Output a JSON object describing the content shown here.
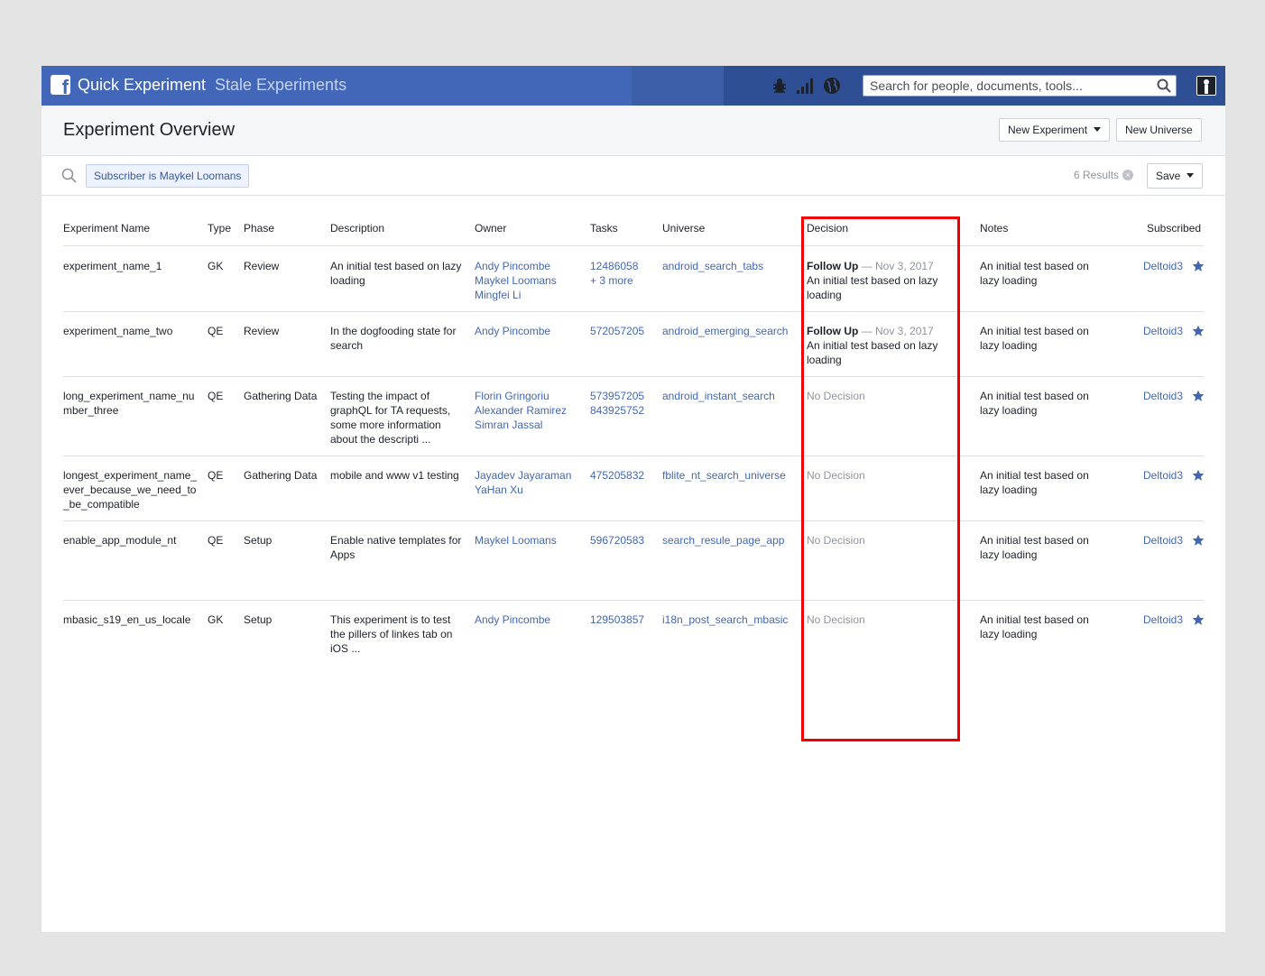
{
  "topbar": {
    "app_name": "Quick Experiment",
    "section": "Stale Experiments",
    "search_placeholder": "Search for people, documents, tools...",
    "fb_letter": "f",
    "brand_color": "#4367b8"
  },
  "header": {
    "title": "Experiment Overview",
    "new_experiment_label": "New Experiment",
    "new_universe_label": "New Universe"
  },
  "filter": {
    "chip_prefix": "Subscriber is ",
    "chip_value": "Maykel Loomans",
    "results": "6 Results",
    "save_label": "Save"
  },
  "table": {
    "columns": [
      "Experiment Name",
      "Type",
      "Phase",
      "Description",
      "Owner",
      "Tasks",
      "Universe",
      "Decision",
      "Notes",
      "Subscribed"
    ],
    "rows": [
      {
        "name": [
          "experiment_name_1"
        ],
        "type": "GK",
        "phase": "Review",
        "description": [
          "An initial test based on lazy",
          "loading"
        ],
        "owners": [
          "Andy Pincombe",
          "Maykel Loomans",
          "Mingfei Li"
        ],
        "tasks": [
          "12486058",
          "+ 3 more"
        ],
        "universe": "android_search_tabs",
        "decision_status": "Follow Up",
        "decision_date": "— Nov 3, 2017",
        "decision_note": [
          "An initial test based on lazy",
          "loading"
        ],
        "notes": [
          "An initial test based on",
          "lazy loading"
        ],
        "subscriber": "Deltoid3"
      },
      {
        "name": [
          "experiment_name_two"
        ],
        "type": "QE",
        "phase": "Review",
        "description": [
          "In the dogfooding state for",
          "search"
        ],
        "owners": [
          "Andy Pincombe"
        ],
        "tasks": [
          "572057205"
        ],
        "universe": "android_emerging_search",
        "decision_status": "Follow Up",
        "decision_date": "— Nov 3, 2017",
        "decision_note": [
          "An initial test based on lazy",
          "loading"
        ],
        "notes": [
          "An initial test based on",
          "lazy loading"
        ],
        "subscriber": "Deltoid3"
      },
      {
        "name": [
          "long_experiment_name_nu",
          "mber_three"
        ],
        "type": "QE",
        "phase": "Gathering Data",
        "description": [
          "Testing the impact of",
          "graphQL for TA requests,",
          "some more information",
          "about the descripti ..."
        ],
        "owners": [
          "Florin Gringoriu",
          "Alexander Ramirez",
          "Simran Jassal"
        ],
        "tasks": [
          "573957205",
          "843925752"
        ],
        "universe": "android_instant_search",
        "decision_status": "No Decision",
        "notes": [
          "An initial test based on",
          "lazy loading"
        ],
        "subscriber": "Deltoid3"
      },
      {
        "name": [
          "longest_experiment_name_",
          "ever_because_we_need_to",
          "_be_compatible"
        ],
        "type": "QE",
        "phase": "Gathering Data",
        "description": [
          "mobile and www v1 testing"
        ],
        "owners": [
          "Jayadev Jayaraman",
          "YaHan Xu"
        ],
        "tasks": [
          "475205832"
        ],
        "universe": "fblite_nt_search_universe",
        "decision_status": "No Decision",
        "notes": [
          "An initial test based on",
          "lazy loading"
        ],
        "subscriber": "Deltoid3"
      },
      {
        "name": [
          "enable_app_module_nt"
        ],
        "type": "QE",
        "phase": "Setup",
        "description": [
          "Enable native templates for",
          "Apps"
        ],
        "owners": [
          "Maykel Loomans"
        ],
        "tasks": [
          "596720583"
        ],
        "universe": "search_resule_page_app",
        "decision_status": "No Decision",
        "notes": [
          "An initial test based on",
          "lazy loading"
        ],
        "subscriber": "Deltoid3"
      },
      {
        "name": [
          "mbasic_s19_en_us_locale"
        ],
        "type": "GK",
        "phase": "Setup",
        "description": [
          "This experiment is to test",
          "the pillers of linkes tab on",
          "iOS ..."
        ],
        "owners": [
          "Andy Pincombe"
        ],
        "tasks": [
          "129503857"
        ],
        "universe": "i18n_post_search_mbasic",
        "decision_status": "No Decision",
        "notes": [
          "An initial test based on",
          "lazy loading"
        ],
        "subscriber": "Deltoid3"
      }
    ]
  }
}
